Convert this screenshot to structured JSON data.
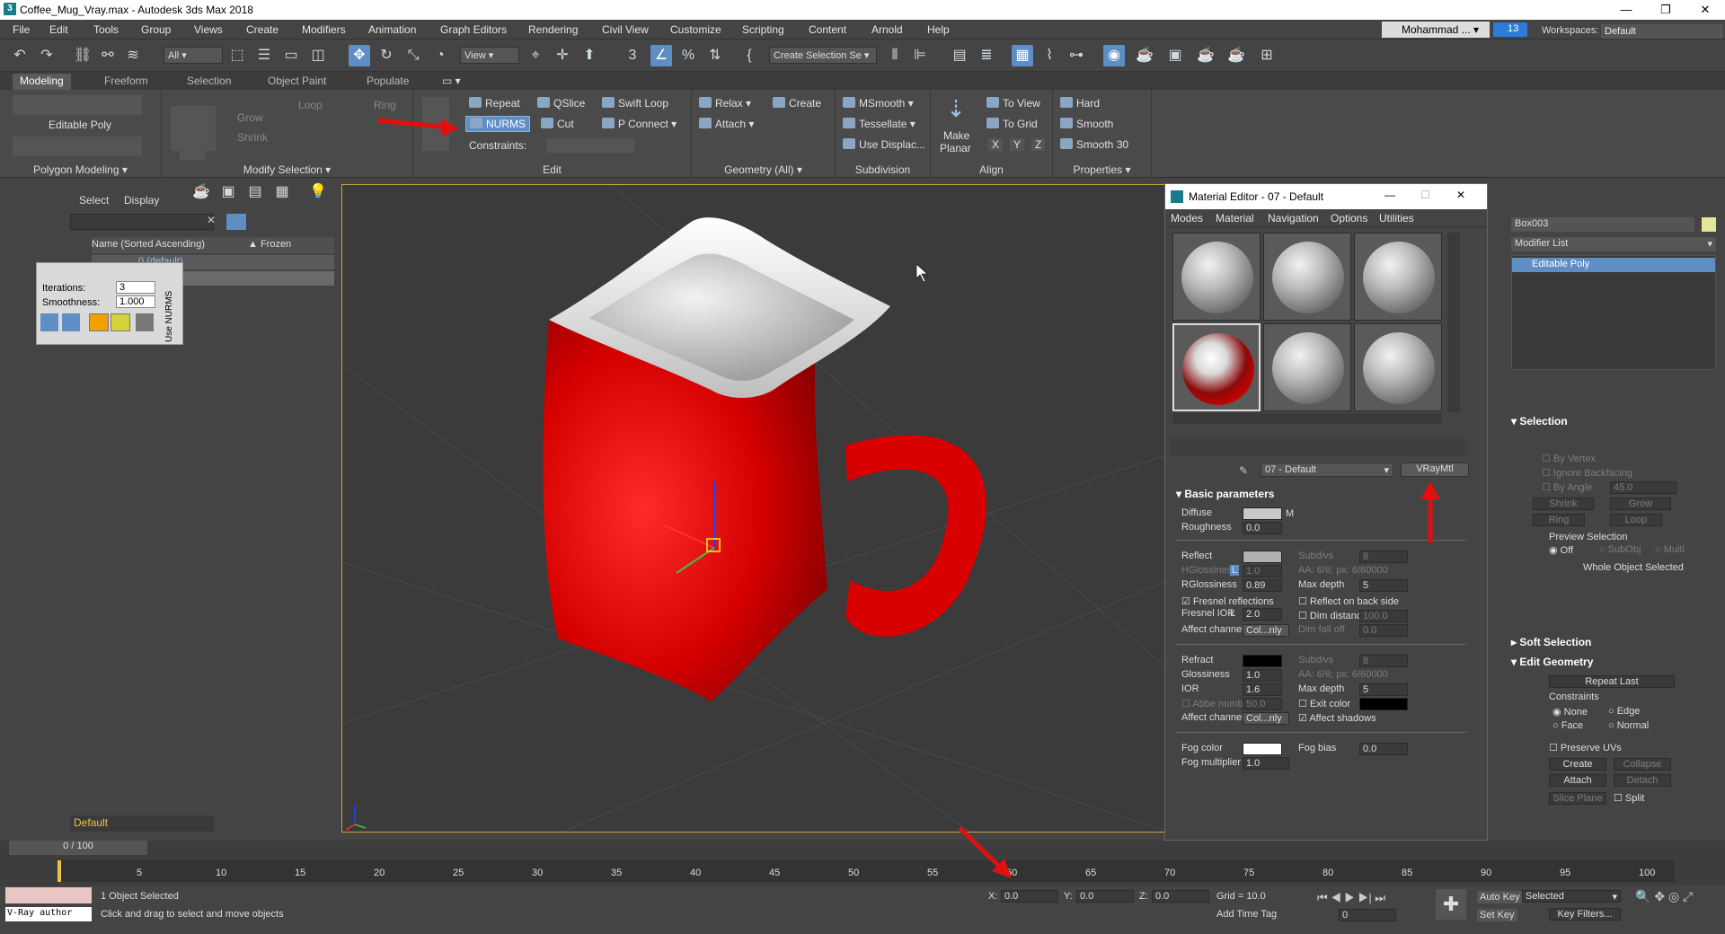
{
  "window": {
    "title": "Coffee_Mug_Vray.max - Autodesk 3ds Max 2018",
    "app_icon": "3"
  },
  "menubar": [
    "File",
    "Edit",
    "Tools",
    "Group",
    "Views",
    "Create",
    "Modifiers",
    "Animation",
    "Graph Editors",
    "Rendering",
    "Civil View",
    "Customize",
    "Scripting",
    "Content",
    "Arnold",
    "Help"
  ],
  "user": {
    "name": "Mohammad ...",
    "notifications": "13",
    "workspaces_label": "Workspaces:",
    "workspace": "Default"
  },
  "toolbar": {
    "filter": "All",
    "view": "View",
    "selection_set": "Create Selection Se"
  },
  "ribbon_tabs": [
    "Modeling",
    "Freeform",
    "Selection",
    "Object Paint",
    "Populate"
  ],
  "ribbon": {
    "polygon_modeling": {
      "label": "Polygon Modeling",
      "obj": "Editable Poly"
    },
    "modify_selection": {
      "label": "Modify Selection",
      "grow": "Grow",
      "shrink": "Shrink",
      "loop": "Loop",
      "ring": "Ring"
    },
    "edit": {
      "label": "Edit",
      "repeat": "Repeat",
      "qslice": "QSlice",
      "swift_loop": "Swift Loop",
      "nurms": "NURMS",
      "cut": "Cut",
      "p_connect": "P Connect",
      "constraints": "Constraints:"
    },
    "geometry": {
      "label": "Geometry (All)",
      "relax": "Relax",
      "create": "Create",
      "attach": "Attach"
    },
    "subdivision": {
      "label": "Subdivision",
      "msmooth": "MSmooth",
      "tessellate": "Tessellate",
      "use_displac": "Use Displac..."
    },
    "align": {
      "label": "Align",
      "make_planar_1": "Make",
      "make_planar_2": "Planar",
      "to_view": "To View",
      "to_grid": "To Grid",
      "x": "X",
      "y": "Y",
      "z": "Z"
    },
    "properties": {
      "label": "Properties",
      "hard": "Hard",
      "smooth": "Smooth",
      "smooth30": "Smooth 30"
    }
  },
  "scene_explorer": {
    "select": "Select",
    "display": "Display",
    "col_name": "Name (Sorted Ascending)",
    "col_frozen": "▲ Frozen",
    "layer": "0 (default)",
    "layer_footer": "Default"
  },
  "nurms_panel": {
    "iterations_label": "Iterations:",
    "iterations": "3",
    "smoothness_label": "Smoothness:",
    "smoothness": "1.000",
    "side_label": "Use NURMS"
  },
  "material_editor": {
    "title": "Material Editor - 07 - Default",
    "menu": [
      "Modes",
      "Material",
      "Navigation",
      "Options",
      "Utilities"
    ],
    "material_name": "07 - Default",
    "material_type": "VRayMtl",
    "rollout": "Basic parameters",
    "diffuse": {
      "label": "Diffuse",
      "map": "M"
    },
    "roughness": {
      "label": "Roughness",
      "value": "0.0"
    },
    "reflect": {
      "label": "Reflect",
      "subdivs_label": "Subdivs",
      "subdivs": "8"
    },
    "hglossiness": {
      "label": "HGlossiness",
      "lock": "L",
      "value": "1.0",
      "aa": "AA: 6/6; px: 6/60000"
    },
    "rglossiness": {
      "label": "RGlossiness",
      "value": "0.89",
      "max_depth_label": "Max depth",
      "max_depth": "5"
    },
    "fresnel": {
      "label": "Fresnel reflections",
      "back_side": "Reflect on back side"
    },
    "fresnel_ior": {
      "label": "Fresnel IOR",
      "lock": "L",
      "value": "2.0",
      "dim_distance_label": "Dim distance",
      "dim_distance": "100.0"
    },
    "affect_channels": {
      "label": "Affect channels",
      "value": "Col...nly",
      "dim_falloff_label": "Dim fall off",
      "dim_falloff": "0.0"
    },
    "refract": {
      "label": "Refract",
      "subdivs_label": "Subdivs",
      "subdivs": "8"
    },
    "glossiness": {
      "label": "Glossiness",
      "value": "1.0",
      "aa": "AA: 6/6; px: 6/60000"
    },
    "ior": {
      "label": "IOR",
      "value": "1.6",
      "max_depth_label": "Max depth",
      "max_depth": "5"
    },
    "abbe": {
      "label": "Abbe number",
      "value": "50.0",
      "exit_label": "Exit color"
    },
    "affect_channels2": {
      "label": "Affect channels",
      "value": "Col...nly",
      "shadows": "Affect shadows"
    },
    "fog_color": {
      "label": "Fog color",
      "bias_label": "Fog bias",
      "bias": "0.0"
    },
    "fog_mult": {
      "label": "Fog multiplier",
      "value": "1.0"
    }
  },
  "command_panel": {
    "object_name": "Box003",
    "modifier_list": "Modifier List",
    "stack_item": "Editable Poly",
    "selection": {
      "title": "Selection",
      "by_vertex": "By Vertex",
      "ignore_backfacing": "Ignore Backfacing",
      "by_angle": "By Angle:",
      "angle": "45.0",
      "shrink": "Shrink",
      "grow": "Grow",
      "ring": "Ring",
      "loop": "Loop",
      "preview": "Preview Selection",
      "off": "Off",
      "subobj": "SubObj",
      "multi": "Multi",
      "status": "Whole Object Selected"
    },
    "soft_selection": "Soft Selection",
    "edit_geometry": {
      "title": "Edit Geometry",
      "repeat_last": "Repeat Last",
      "constraints": "Constraints",
      "none": "None",
      "edge": "Edge",
      "face": "Face",
      "normal": "Normal",
      "preserve_uvs": "Preserve UVs",
      "create": "Create",
      "collapse": "Collapse",
      "attach": "Attach",
      "detach": "Detach",
      "slice_plane": "Slice Plane",
      "split": "Split"
    }
  },
  "timeline": {
    "frame": "0 / 100",
    "ticks": [
      "5",
      "10",
      "15",
      "20",
      "25",
      "30",
      "35",
      "40",
      "45",
      "50",
      "55",
      "60",
      "65",
      "70",
      "75",
      "80",
      "85",
      "90",
      "95",
      "100"
    ]
  },
  "status": {
    "objects": "1 Object Selected",
    "hint": "Click and drag to select and move objects",
    "maxscript": "V-Ray author",
    "x_label": "X:",
    "x": "0.0",
    "y_label": "Y:",
    "y": "0.0",
    "z_label": "Z:",
    "z": "0.0",
    "grid": "Grid = 10.0",
    "add_time_tag": "Add Time Tag",
    "auto_key": "Auto Key",
    "set_key": "Set Key",
    "selected": "Selected",
    "key_filters": "Key Filters...",
    "frame_value": "0"
  },
  "colors": {
    "accent": "#5e8ec4",
    "mug_red": "#d40000",
    "arrow_red": "#e01010"
  }
}
